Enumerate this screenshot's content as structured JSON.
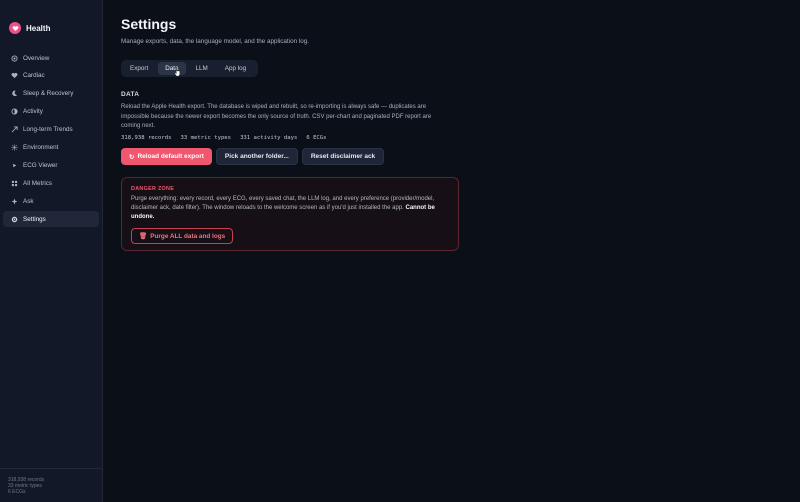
{
  "app": {
    "name": "Health",
    "accent": "#e8538a"
  },
  "sidebar": {
    "items": [
      {
        "label": "Overview",
        "icon": "overview-icon"
      },
      {
        "label": "Cardiac",
        "icon": "heart-icon"
      },
      {
        "label": "Sleep & Recovery",
        "icon": "moon-icon"
      },
      {
        "label": "Activity",
        "icon": "activity-icon"
      },
      {
        "label": "Long-term Trends",
        "icon": "trend-icon"
      },
      {
        "label": "Environment",
        "icon": "sun-icon"
      },
      {
        "label": "ECG Viewer",
        "icon": "ecg-icon"
      },
      {
        "label": "All Metrics",
        "icon": "grid-icon"
      },
      {
        "label": "Ask",
        "icon": "sparkle-icon"
      },
      {
        "label": "Settings",
        "icon": "gear-icon",
        "active": true
      }
    ],
    "footer": {
      "records": "318,938 records",
      "metric_types": "33 metric types",
      "ecgs": "6 ECGs"
    }
  },
  "page": {
    "title": "Settings",
    "subtitle": "Manage exports, data, the language model, and the application log."
  },
  "tabs": [
    {
      "label": "Export"
    },
    {
      "label": "Data",
      "active": true
    },
    {
      "label": "LLM"
    },
    {
      "label": "App log"
    }
  ],
  "data_section": {
    "heading": "DATA",
    "description": "Reload the Apple Health export. The database is wiped and rebuilt, so re-importing is always safe — duplicates are impossible because the newer export becomes the only source of truth. CSV per-chart and paginated PDF report are coming next.",
    "stats": {
      "records": "318,938 records",
      "metric_types": "33 metric types",
      "activity_days": "331 activity days",
      "ecgs": "6 ECGs"
    },
    "buttons": {
      "reload": "Reload default export",
      "reload_icon": "↻",
      "pick": "Pick another folder...",
      "reset": "Reset disclaimer ack"
    }
  },
  "danger_zone": {
    "title": "DANGER ZONE",
    "text": "Purge everything: every record, every ECG, every saved chat, the LLM log, and every preference (provider/model, disclaimer ack, date filter). The window reloads to the welcome screen as if you'd just installed the app.",
    "emphasis": "Cannot be undone.",
    "button": "Purge ALL data and logs",
    "button_icon": "🗑",
    "color": "#f0566e"
  }
}
